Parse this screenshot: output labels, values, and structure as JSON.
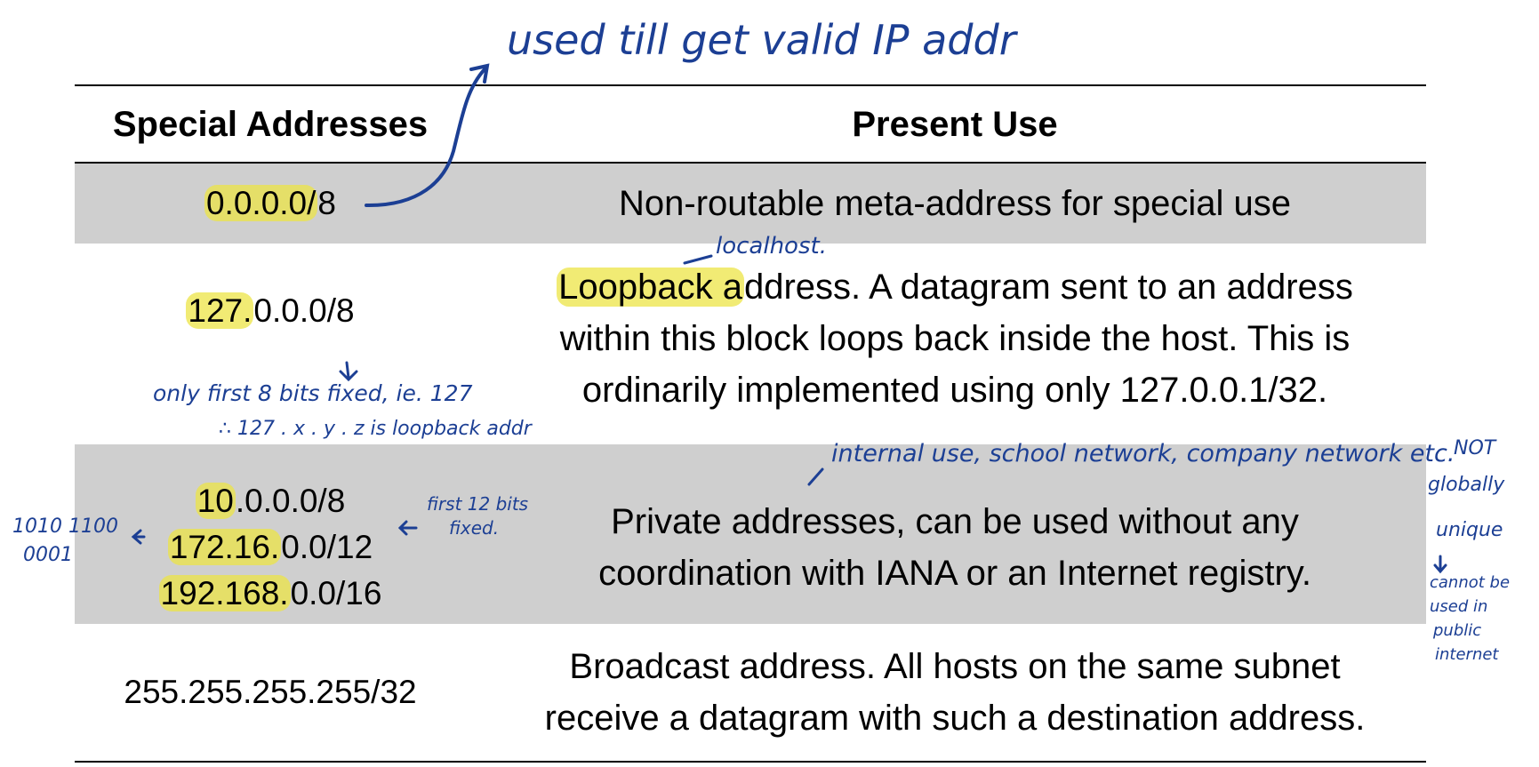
{
  "table": {
    "headers": {
      "special_addresses": "Special Addresses",
      "present_use": "Present Use"
    },
    "rows": [
      {
        "address_lines": [
          {
            "highlight": "0.0.0.0/",
            "rest": "8"
          }
        ],
        "use_lines": [
          "Non-routable meta-address for special use"
        ]
      },
      {
        "address_lines": [
          {
            "highlight": "127.",
            "rest": "0.0.0/8"
          }
        ],
        "use_lines": [
          {
            "highlight": "Loopback a",
            "rest": "ddress. A datagram sent to an address"
          },
          "within this block loops back inside the host. This is",
          "ordinarily implemented using only 127.0.0.1/32."
        ]
      },
      {
        "address_lines": [
          {
            "highlight": "10",
            "rest": ".0.0.0/8"
          },
          {
            "highlight": "172.16.",
            "rest": "0.0/12"
          },
          {
            "highlight": "192.168.",
            "rest": "0.0/16"
          }
        ],
        "use_lines": [
          "Private addresses, can be used without any",
          "coordination with IANA or an Internet registry."
        ]
      },
      {
        "address_lines": [
          {
            "highlight": "",
            "rest": "255.255.255.255/32"
          }
        ],
        "use_lines": [
          "Broadcast address. All hosts on the same subnet",
          "receive a datagram with such a destination address."
        ]
      }
    ]
  },
  "annotations": {
    "top_note": "used till get valid IP addr",
    "localhost": "localhost.",
    "first_8_bits": "only first 8 bits fixed, ie. 127",
    "loopback_form": "∴ 127 . x . y . z  is loopback addr",
    "internal_use": "internal use, school network, company network etc.",
    "first_12_bits_line1": "first 12 bits",
    "first_12_bits_line2": "fixed.",
    "binary_line1": "1010 1100",
    "binary_line2": "0001",
    "not_globally_1": "NOT",
    "not_globally_2": "globally",
    "not_globally_3": "unique",
    "cannot_1": "cannot be",
    "cannot_2": "used in",
    "cannot_3": "public",
    "cannot_4": "internet"
  },
  "colors": {
    "shade": "#cfcfcf",
    "highlight": "#ece446",
    "ink": "#1c3f94"
  }
}
